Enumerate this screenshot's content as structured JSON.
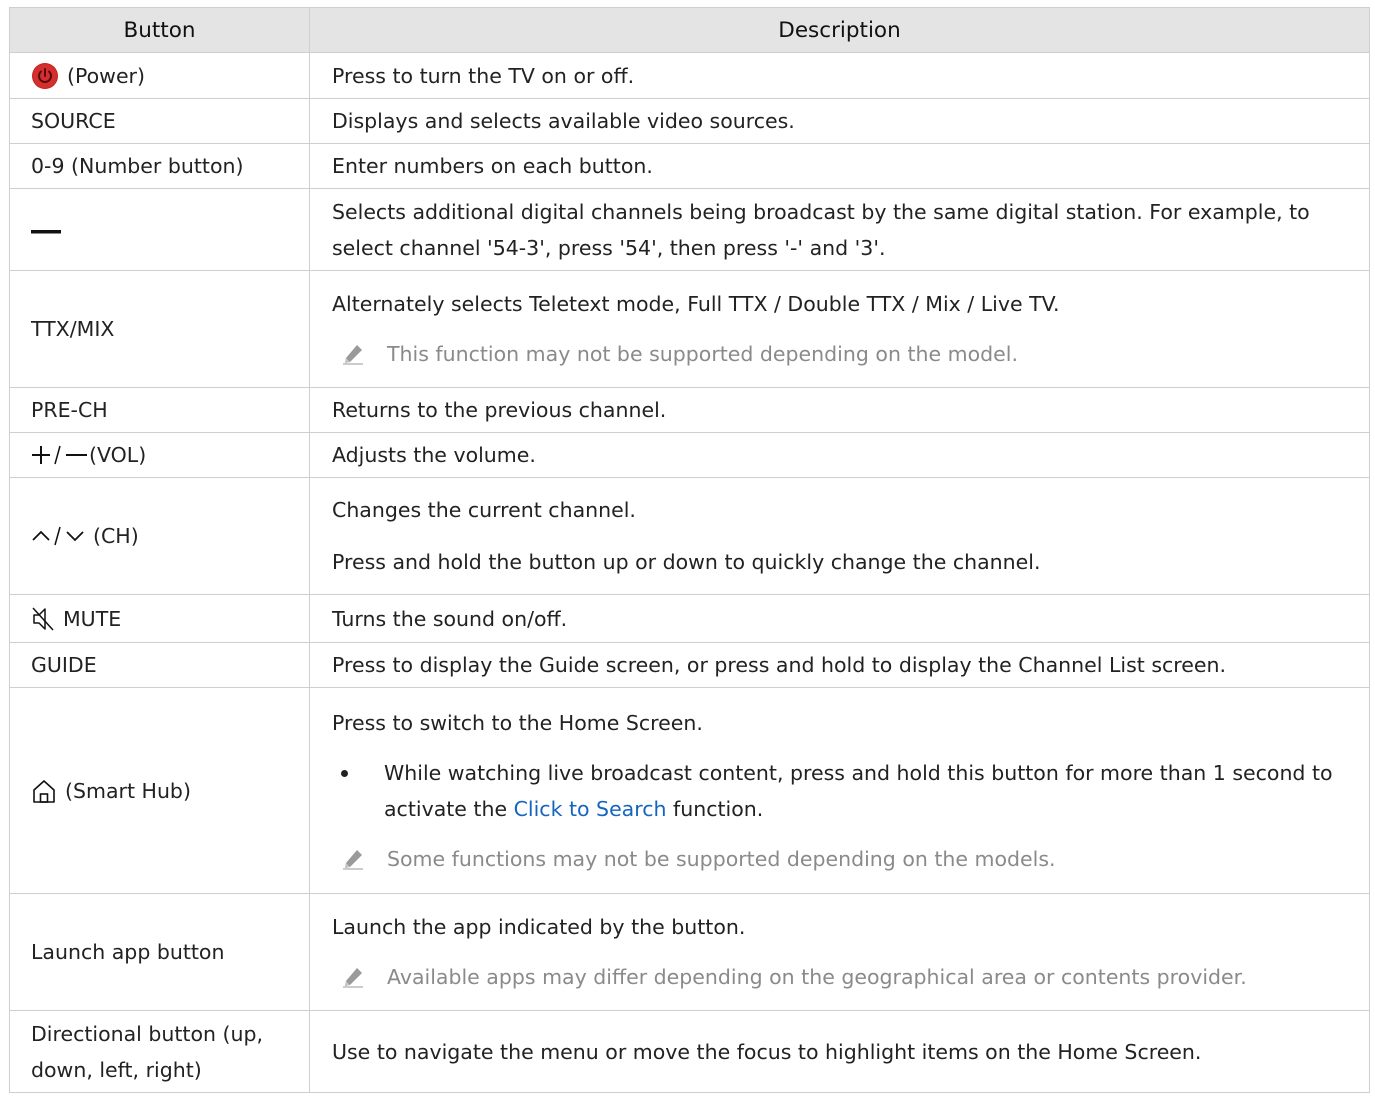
{
  "table": {
    "headers": {
      "button": "Button",
      "description": "Description"
    },
    "rows": [
      {
        "id": "power",
        "icon": "power-icon",
        "button_label": "(Power)",
        "lines": [
          "Press to turn the TV on or off."
        ]
      },
      {
        "id": "source",
        "button_label": "SOURCE",
        "lines": [
          "Displays and selects available video sources."
        ]
      },
      {
        "id": "number",
        "button_label": "0-9 (Number button)",
        "lines": [
          "Enter numbers on each button."
        ]
      },
      {
        "id": "dash",
        "icon": "dash-icon",
        "button_label": "",
        "lines": [
          "Selects additional digital channels being broadcast by the same digital station. For example, to select channel '54-3', press '54', then press '-' and '3'."
        ]
      },
      {
        "id": "ttx",
        "button_label": "TTX/MIX",
        "lines": [
          "Alternately selects Teletext mode, Full TTX / Double TTX / Mix / Live TV."
        ],
        "note": "This function may not be supported depending on the model."
      },
      {
        "id": "prech",
        "button_label": "PRE-CH",
        "lines": [
          "Returns to the previous channel."
        ]
      },
      {
        "id": "vol",
        "icon": "plus-minus-icon",
        "button_label": "(VOL)",
        "lines": [
          "Adjusts the volume."
        ]
      },
      {
        "id": "ch",
        "icon": "up-down-chevron-icon",
        "button_label": "(CH)",
        "lines": [
          "Changes the current channel.",
          "Press and hold the button up or down to quickly change the channel."
        ]
      },
      {
        "id": "mute",
        "icon": "mute-icon",
        "button_label": "MUTE",
        "lines": [
          "Turns the sound on/off."
        ]
      },
      {
        "id": "guide",
        "button_label": "GUIDE",
        "lines": [
          "Press to display the Guide screen, or press and hold to display the Channel List screen."
        ]
      },
      {
        "id": "home",
        "icon": "home-icon",
        "button_label": "(Smart Hub)",
        "lines": [
          "Press to switch to the Home Screen."
        ],
        "bullet": {
          "before": "While watching live broadcast content, press and hold this button for more than 1 second to activate the ",
          "link": "Click to Search",
          "after": " function."
        },
        "note": "Some functions may not be supported depending on the models."
      },
      {
        "id": "launch",
        "button_label": "Launch app button",
        "lines": [
          "Launch the app indicated by the button."
        ],
        "note": "Available apps may differ depending on the geographical area or contents provider."
      },
      {
        "id": "dir",
        "button_label": "Directional button (up, down, left, right)",
        "lines": [
          "Use to navigate the menu or move the focus to highlight items on the Home Screen."
        ]
      }
    ]
  },
  "colors": {
    "header_bg": "#e4e4e4",
    "border": "#cfcfcf",
    "note_text": "#8a8a8a",
    "link": "#1565c0",
    "power_icon": "#d32f2f"
  }
}
